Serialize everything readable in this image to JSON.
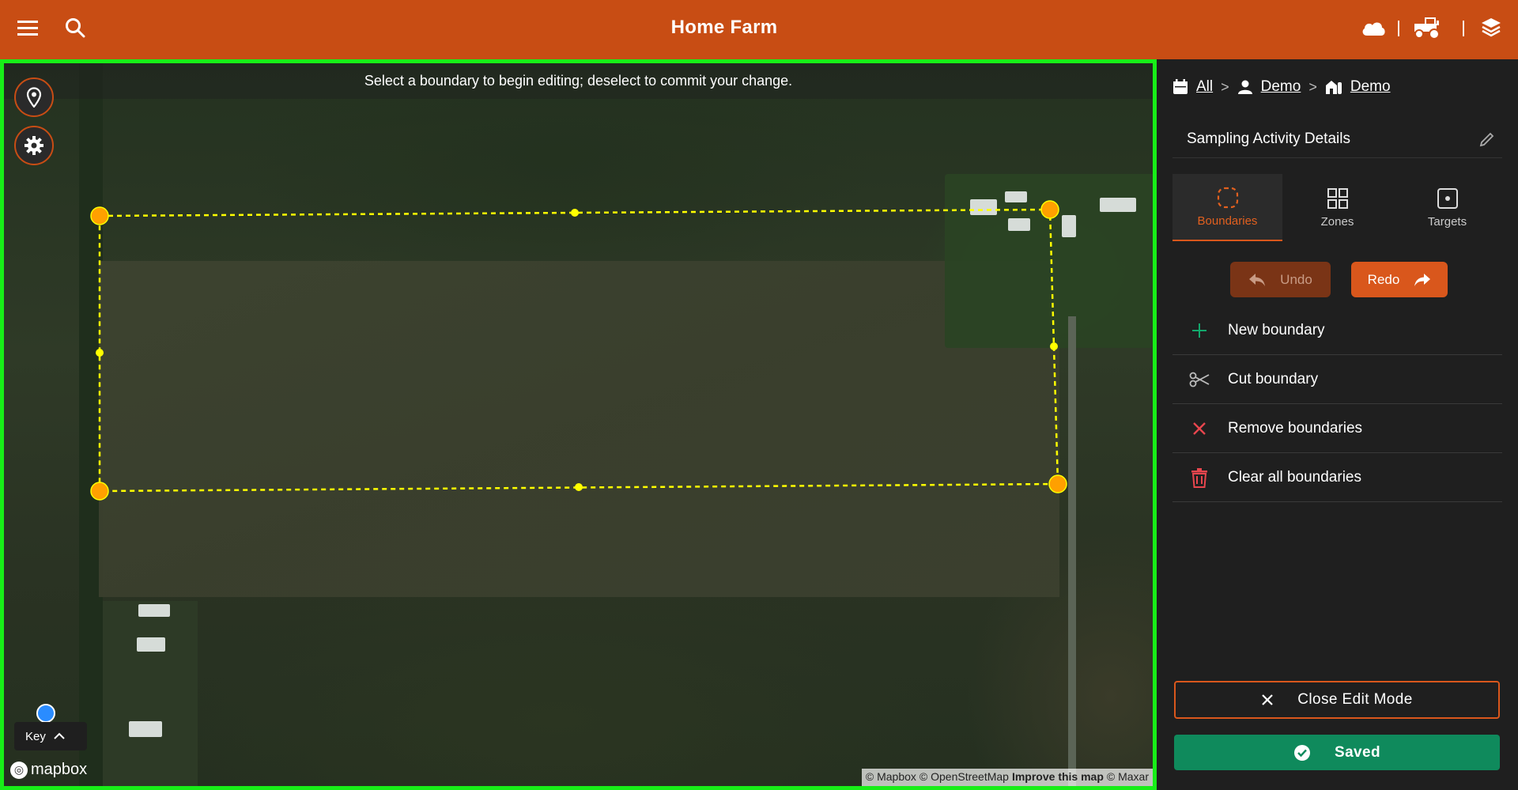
{
  "header": {
    "title": "Home Farm",
    "menu_icon": "menu-icon",
    "search_icon": "search-icon",
    "weather_icon": "cloud-icon",
    "equipment_icon": "tractor-icon",
    "layers_icon": "layers-icon",
    "bg_color": "#c84d14"
  },
  "map": {
    "banner": "Select a boundary to begin editing; deselect to commit your change.",
    "location_button_icon": "location-pin-icon",
    "settings_button_icon": "gear-icon",
    "key_label": "Key",
    "logo_text": "mapbox",
    "attribution": {
      "mapbox": "© Mapbox",
      "osm": "© OpenStreetMap",
      "improve": "Improve this map",
      "maxar": "© Maxar"
    },
    "border_color": "#18ee18",
    "boundary_color": "#ffff00",
    "vertex_color": "#ffa000"
  },
  "panel": {
    "breadcrumb": {
      "all": "All",
      "user": "Demo",
      "farm": "Demo"
    },
    "details_title": "Sampling Activity Details",
    "tabs": [
      {
        "label": "Boundaries",
        "icon": "boundary-icon",
        "active": true
      },
      {
        "label": "Zones",
        "icon": "grid-icon",
        "active": false
      },
      {
        "label": "Targets",
        "icon": "target-icon",
        "active": false
      }
    ],
    "undo_label": "Undo",
    "redo_label": "Redo",
    "actions": [
      {
        "label": "New boundary",
        "icon": "plus-icon"
      },
      {
        "label": "Cut boundary",
        "icon": "scissors-icon"
      },
      {
        "label": "Remove boundaries",
        "icon": "x-icon"
      },
      {
        "label": "Clear all boundaries",
        "icon": "trash-icon"
      }
    ],
    "close_edit_label": "Close Edit Mode",
    "saved_label": "Saved",
    "accent_color": "#d9571c",
    "saved_color": "#0f8a5c"
  }
}
